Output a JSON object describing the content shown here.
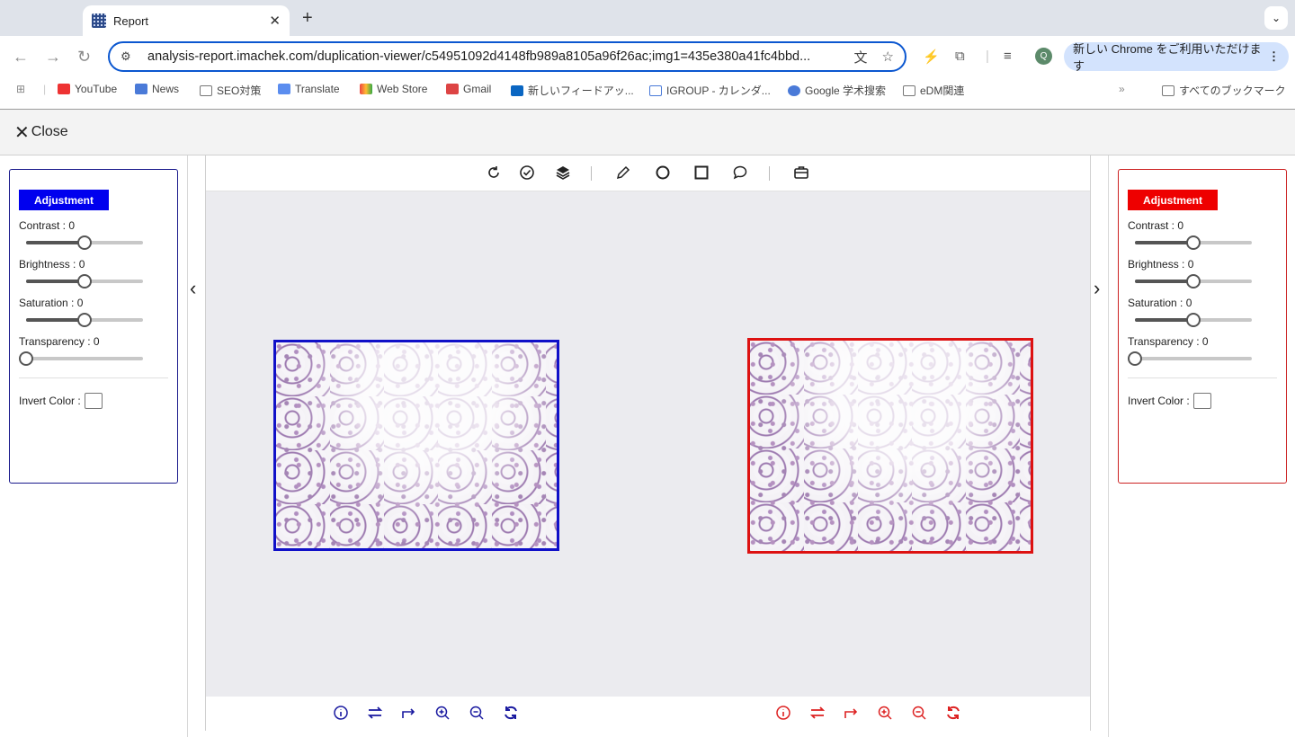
{
  "browser": {
    "tab_title": "Report",
    "new_tab_symbol": "+",
    "url": "analysis-report.imachek.com/duplication-viewer/c54951092d4148fb989a8105a96f26ac;img1=435e380a41fc4bbd...",
    "profile_initial": "Q",
    "chrome_notice": "新しい Chrome をご利用いただけます",
    "bookmarks": [
      "YouTube",
      "News",
      "SEO対策",
      "Translate",
      "Web Store",
      "Gmail",
      "新しいフィードアッ...",
      "IGROUP - カレンダ...",
      "Google 学术搜索",
      "eDM関連"
    ],
    "all_bookmarks": "すべてのブックマーク"
  },
  "app": {
    "close_label": "Close",
    "left_panel": {
      "title": "Adjustment",
      "accent": "#0000ee",
      "contrast_label": "Contrast : 0",
      "brightness_label": "Brightness : 0",
      "saturation_label": "Saturation : 0",
      "transparency_label": "Transparency : 0",
      "invert_label": "Invert Color :",
      "contrast_value": 0.5,
      "brightness_value": 0.5,
      "saturation_value": 0.5,
      "transparency_value": 0
    },
    "right_panel": {
      "title": "Adjustment",
      "accent": "#ee0000",
      "contrast_label": "Contrast : 0",
      "brightness_label": "Brightness : 0",
      "saturation_label": "Saturation : 0",
      "transparency_label": "Transparency : 0",
      "invert_label": "Invert Color :",
      "contrast_value": 0.5,
      "brightness_value": 0.5,
      "saturation_value": 0.5,
      "transparency_value": 0
    },
    "top_tools": [
      "rotate-icon",
      "check-circle-icon",
      "layers-icon",
      "pencil-icon",
      "circle-icon",
      "square-icon",
      "comment-icon",
      "briefcase-icon"
    ],
    "bottom_tools": [
      "info-icon",
      "swap-icon",
      "redo-arrow-icon",
      "zoom-in-icon",
      "zoom-out-icon",
      "refresh-icon"
    ],
    "left_tool_color": "#1a1aa0",
    "right_tool_color": "#dd2222"
  }
}
